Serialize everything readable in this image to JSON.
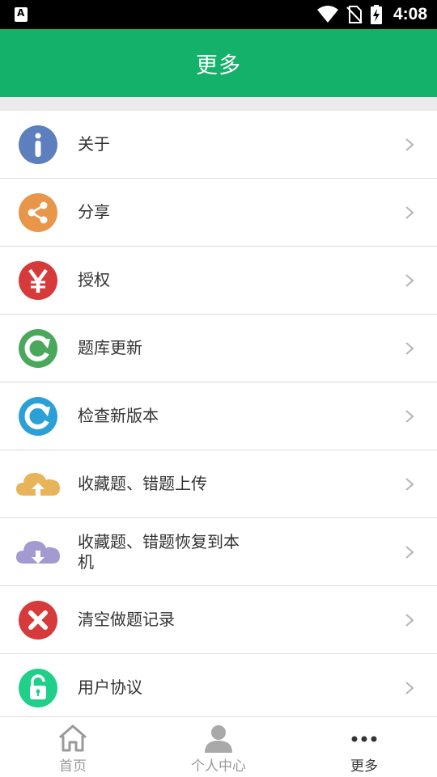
{
  "status_bar": {
    "time": "4:08"
  },
  "header": {
    "title": "更多"
  },
  "menu": [
    {
      "label": "关于",
      "icon": "info-icon",
      "color": "#5e7fbd"
    },
    {
      "label": "分享",
      "icon": "share-icon",
      "color": "#e8964a"
    },
    {
      "label": "授权",
      "icon": "yen-icon",
      "color": "#d63a3a"
    },
    {
      "label": "题库更新",
      "icon": "refresh-green-icon",
      "color": "#4aa85c"
    },
    {
      "label": "检查新版本",
      "icon": "refresh-blue-icon",
      "color": "#2aa0d6"
    },
    {
      "label": "收藏题、错题上传",
      "icon": "cloud-upload-icon",
      "color": "#e8b45a"
    },
    {
      "label": "收藏题、错题恢复到本机",
      "icon": "cloud-download-icon",
      "color": "#a39ad0"
    },
    {
      "label": "清空做题记录",
      "icon": "clear-icon",
      "color": "#d63a3a"
    },
    {
      "label": "用户协议",
      "icon": "unlock-icon",
      "color": "#1fcf8a"
    }
  ],
  "tabs": [
    {
      "label": "首页",
      "icon": "home-icon",
      "active": false
    },
    {
      "label": "个人中心",
      "icon": "user-icon",
      "active": false
    },
    {
      "label": "更多",
      "icon": "more-dots-icon",
      "active": true
    }
  ],
  "colors": {
    "accent": "#14b16a",
    "divider": "#dcdcdc",
    "background_gap": "#ebebeb"
  }
}
